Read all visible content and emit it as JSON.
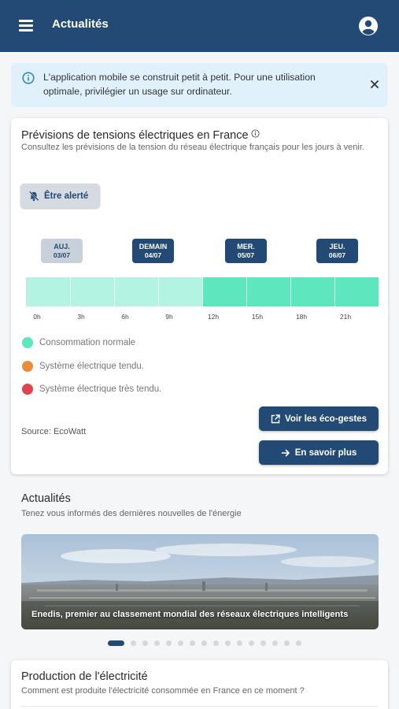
{
  "appbar": {
    "title": "Actualités",
    "menu_icon": "hamburger-menu-icon",
    "account_icon": "account-circle-icon"
  },
  "banner": {
    "text": "L'application mobile se construit petit à petit. Pour une utilisation optimale, privilégier un usage sur ordinateur.",
    "icon": "info-icon",
    "close_icon": "close-icon"
  },
  "forecast": {
    "title": "Prévisions de tensions électriques en France",
    "subtitle": "Consultez les prévisions de la tension du réseau électrique français pour les jours à venir.",
    "alert_button": "Être alerté",
    "days": [
      {
        "day": "AUJ.",
        "date": "03/07",
        "selected": true
      },
      {
        "day": "DEMAIN",
        "date": "04/07",
        "selected": false
      },
      {
        "day": "MER.",
        "date": "05/07",
        "selected": false
      },
      {
        "day": "JEU.",
        "date": "06/07",
        "selected": false
      }
    ],
    "hours": [
      "0h",
      "3h",
      "6h",
      "9h",
      "12h",
      "15h",
      "18h",
      "21h"
    ],
    "segments": [
      {
        "status": "normal",
        "past": true
      },
      {
        "status": "normal",
        "past": true
      },
      {
        "status": "normal",
        "past": true
      },
      {
        "status": "normal",
        "past": true
      },
      {
        "status": "normal",
        "past": false
      },
      {
        "status": "normal",
        "past": false
      },
      {
        "status": "normal",
        "past": false
      },
      {
        "status": "normal",
        "past": false
      }
    ],
    "legend": [
      {
        "label": "Consommation normale",
        "color": "#5ee6bf"
      },
      {
        "label": "Système électrique tendu.",
        "color": "#ea8c3c"
      },
      {
        "label": "Système électrique très tendu.",
        "color": "#e0434e"
      }
    ],
    "source": "Source: EcoWatt",
    "eco_button": "Voir les éco-gestes",
    "more_button": "En savoir plus"
  },
  "news": {
    "title": "Actualités",
    "subtitle": "Tenez vous informés des dernières nouvelles de l'énergie",
    "caption": "Enedis, premier au classement mondial des réseaux électriques intelligents",
    "page_count": 16,
    "current_page": 1
  },
  "production": {
    "title": "Production de l'électricité",
    "subtitle": "Comment est produite l'électricité consommée en France en ce moment ?"
  },
  "colors": {
    "primary": "#234a74",
    "normal": "#5ee6bf",
    "normal_past": "#b3f3e1",
    "tense": "#ea8c3c",
    "very_tense": "#e0434e"
  }
}
